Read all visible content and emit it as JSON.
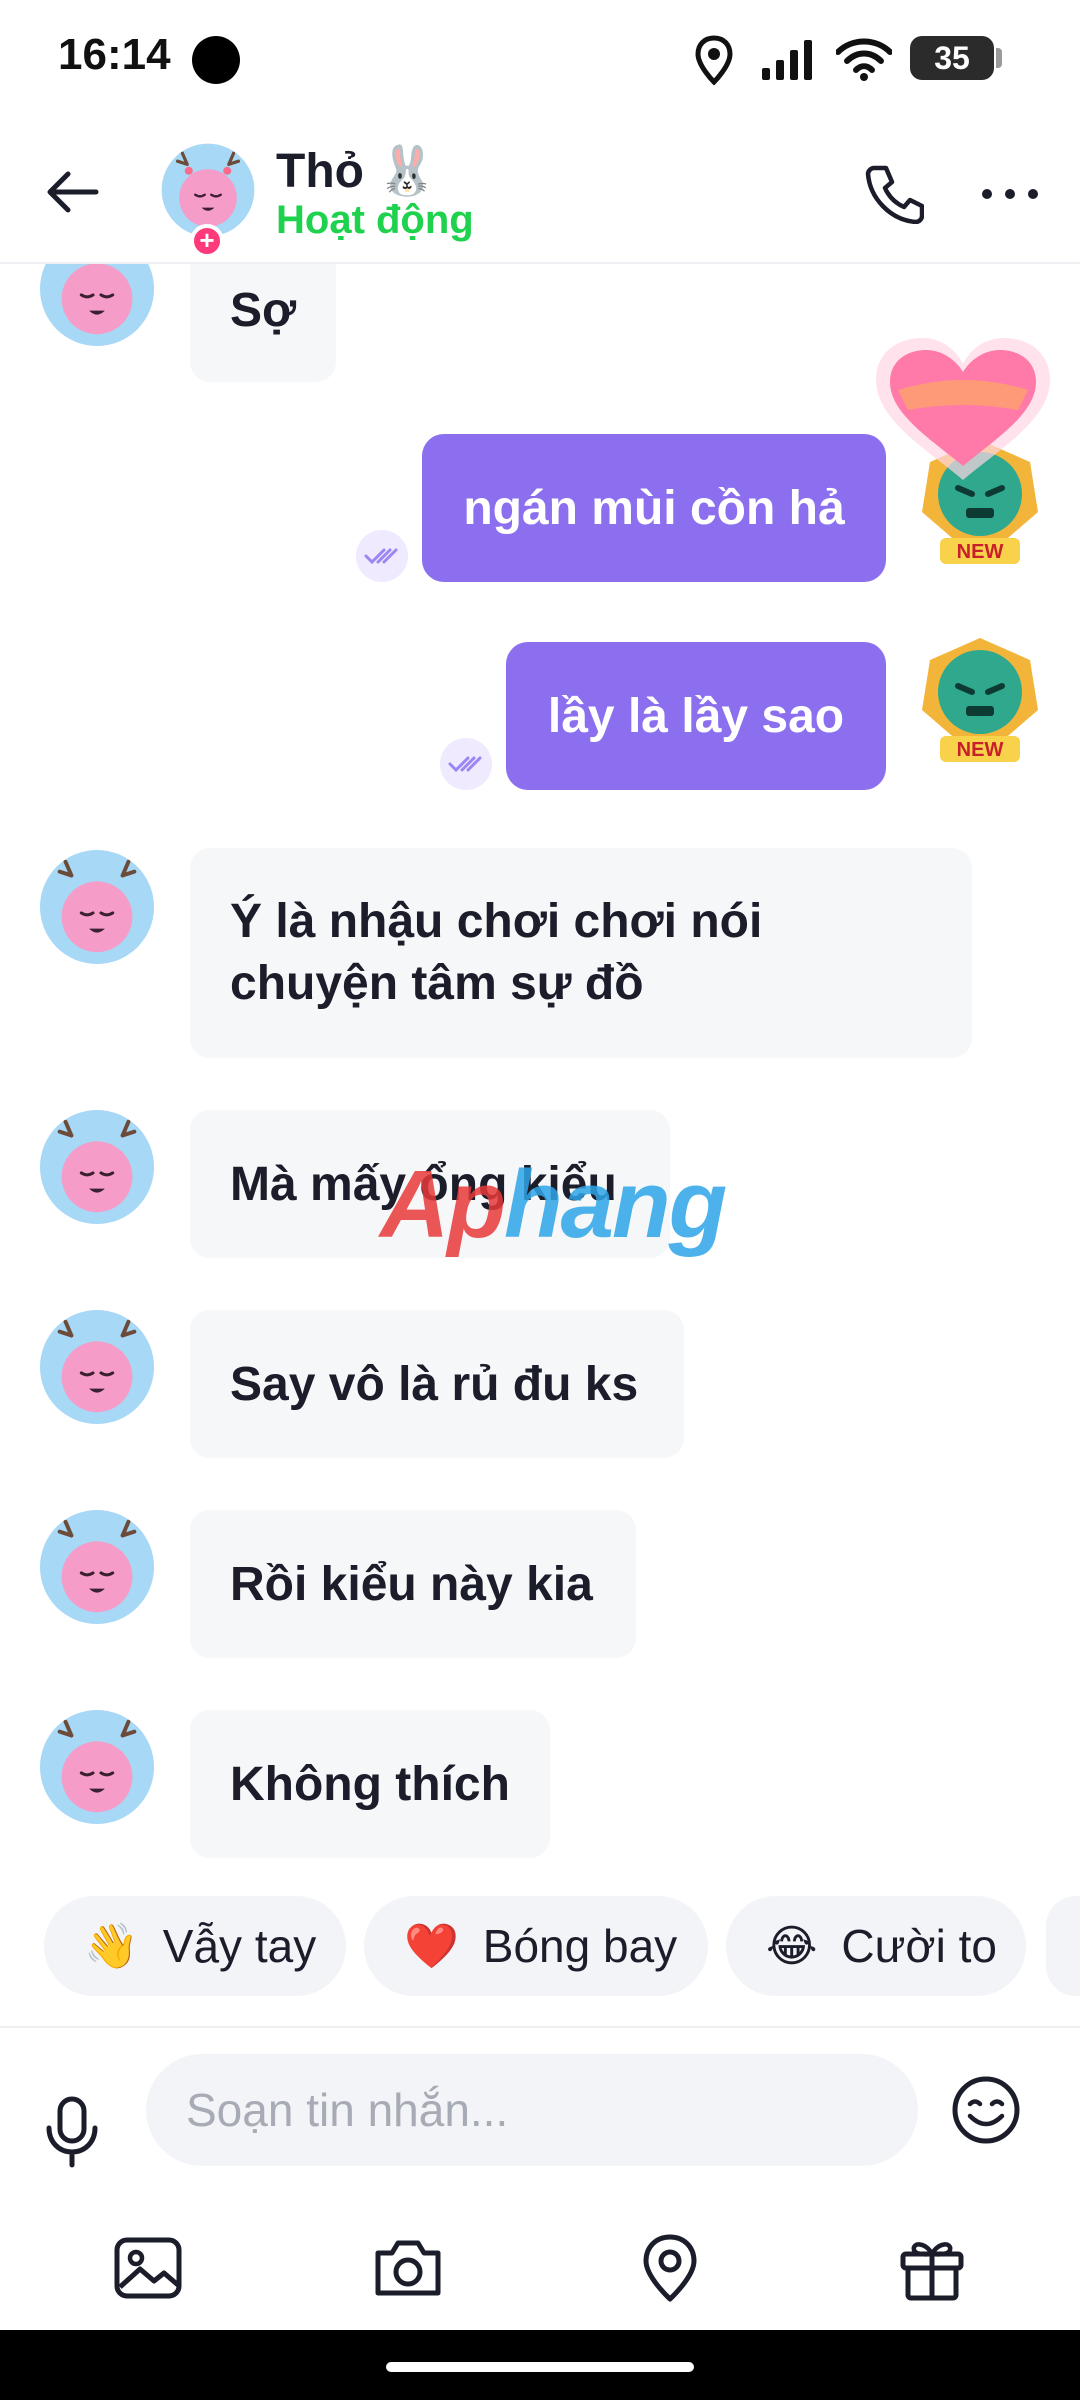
{
  "status_bar": {
    "time": "16:14",
    "battery": "35",
    "icons": [
      "camera-dot",
      "location-icon",
      "signal-icon",
      "wifi-icon",
      "battery-icon"
    ]
  },
  "header": {
    "contact_name": "Thỏ 🐰",
    "status": "Hoạt động",
    "status_color": "#1fd24e",
    "icons": [
      "back-arrow-icon",
      "call-icon",
      "more-icon"
    ]
  },
  "messages": [
    {
      "direction": "in",
      "text": "Sợ"
    },
    {
      "direction": "out",
      "text": "ngán mùi cồn hả",
      "read": true
    },
    {
      "direction": "out",
      "text": "lầy là lầy sao",
      "read": true
    },
    {
      "direction": "in",
      "text": "Ý là nhậu chơi chơi nói chuyện tâm sự đồ"
    },
    {
      "direction": "in",
      "text": "Mà mấy ổng kiểu"
    },
    {
      "direction": "in",
      "text": "Say vô là rủ đu ks"
    },
    {
      "direction": "in",
      "text": "Rồi kiểu này kia"
    },
    {
      "direction": "in",
      "text": "Không thích"
    }
  ],
  "avatar_badge": "NEW",
  "watermark": {
    "part_a": "Ap",
    "part_b": "hang"
  },
  "quick_reactions": [
    {
      "emoji": "👋",
      "label": "Vẫy tay"
    },
    {
      "emoji": "❤️",
      "label": "Bóng bay"
    },
    {
      "emoji": "😂",
      "label": "Cười to"
    }
  ],
  "composer": {
    "placeholder": "Soạn tin nhắn...",
    "icons": [
      "mic-icon",
      "emoji-icon"
    ]
  },
  "toolbar": {
    "icons": [
      "gallery-icon",
      "camera-icon",
      "location-pin-icon",
      "gift-icon"
    ]
  },
  "colors": {
    "outgoing_bubble": "#8b6fef",
    "incoming_bubble": "#f6f7f9",
    "accent_green": "#1fd24e"
  }
}
